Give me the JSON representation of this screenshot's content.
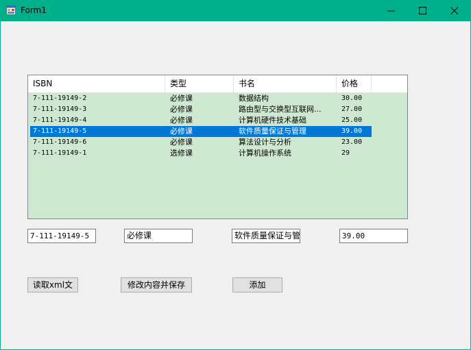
{
  "window": {
    "title": "Form1"
  },
  "listview": {
    "columns": [
      "ISBN",
      "类型",
      "书名",
      "价格"
    ],
    "rows": [
      {
        "isbn": "7-111-19149-2",
        "type": "必修课",
        "name": "数据结构",
        "price": "30.00"
      },
      {
        "isbn": "7-111-19149-3",
        "type": "必修课",
        "name": "路由型与交换型互联网...",
        "price": "27.00"
      },
      {
        "isbn": "7-111-19149-4",
        "type": "必修课",
        "name": "计算机硬件技术基础",
        "price": "25.00"
      },
      {
        "isbn": "7-111-19149-5",
        "type": "必修课",
        "name": "软件质量保证与管理",
        "price": "39.00"
      },
      {
        "isbn": "7-111-19149-6",
        "type": "必修课",
        "name": "算法设计与分析",
        "price": "23.00"
      },
      {
        "isbn": "7-111-19149-1",
        "type": "选修课",
        "name": "计算机操作系统",
        "price": "29"
      }
    ],
    "selected_index": 3
  },
  "fields": {
    "isbn": "7-111-19149-5",
    "type": "必修课",
    "name": "软件质量保证与管",
    "price": "39.00"
  },
  "buttons": {
    "read_xml": "读取xml文",
    "save_changes": "修改内容并保存",
    "add": "添加"
  },
  "colors": {
    "titlebar": "#00b08a",
    "list_background": "#cfe8d1",
    "selection": "#0078d7"
  }
}
